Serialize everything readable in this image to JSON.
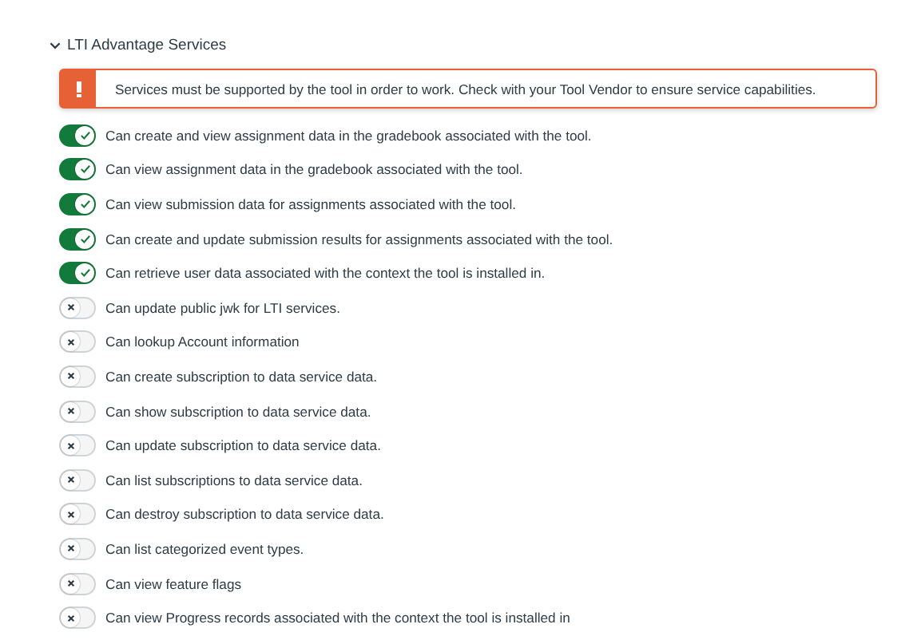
{
  "section": {
    "title": "LTI Advantage Services",
    "expanded": true
  },
  "alert": {
    "message": "Services must be supported by the tool in order to work. Check with your Tool Vendor to ensure service capabilities."
  },
  "services": [
    {
      "label": "Can create and view assignment data in the gradebook associated with the tool.",
      "on": true
    },
    {
      "label": "Can view assignment data in the gradebook associated with the tool.",
      "on": true
    },
    {
      "label": "Can view submission data for assignments associated with the tool.",
      "on": true
    },
    {
      "label": "Can create and update submission results for assignments associated with the tool.",
      "on": true
    },
    {
      "label": "Can retrieve user data associated with the context the tool is installed in.",
      "on": true
    },
    {
      "label": "Can update public jwk for LTI services.",
      "on": false
    },
    {
      "label": "Can lookup Account information",
      "on": false
    },
    {
      "label": "Can create subscription to data service data.",
      "on": false
    },
    {
      "label": "Can show subscription to data service data.",
      "on": false
    },
    {
      "label": "Can update subscription to data service data.",
      "on": false
    },
    {
      "label": "Can list subscriptions to data service data.",
      "on": false
    },
    {
      "label": "Can destroy subscription to data service data.",
      "on": false
    },
    {
      "label": "Can list categorized event types.",
      "on": false
    },
    {
      "label": "Can view feature flags",
      "on": false
    },
    {
      "label": "Can view Progress records associated with the context the tool is installed in",
      "on": false
    }
  ]
}
